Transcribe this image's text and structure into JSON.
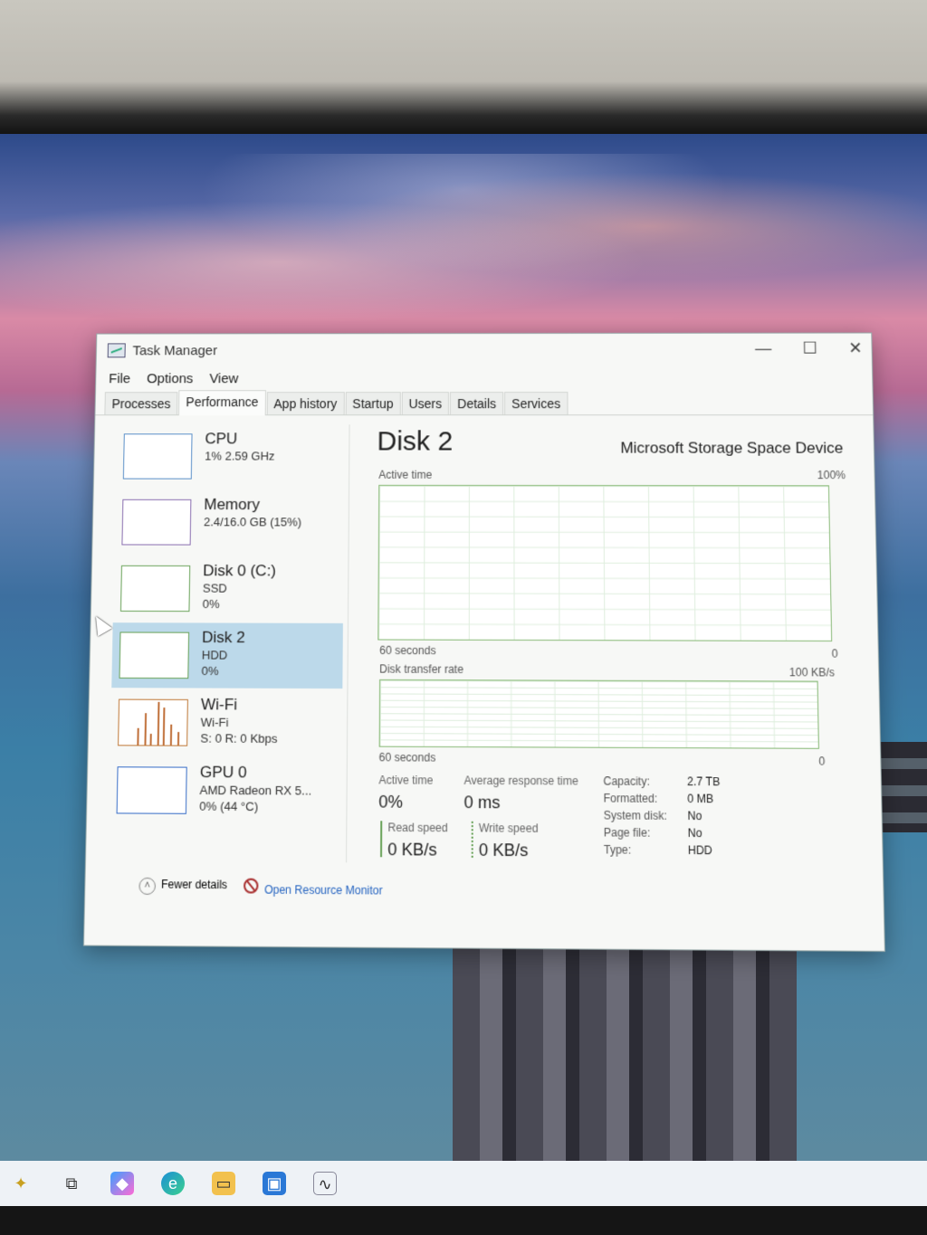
{
  "window": {
    "title": "Task Manager",
    "controls": {
      "minimize": "—",
      "maximize": "☐",
      "close": "✕"
    }
  },
  "menu": [
    "File",
    "Options",
    "View"
  ],
  "tabs": [
    "Processes",
    "Performance",
    "App history",
    "Startup",
    "Users",
    "Details",
    "Services"
  ],
  "active_tab": "Performance",
  "sidebar": [
    {
      "name": "CPU",
      "sub1": "1% 2.59 GHz",
      "sub2": "",
      "sub3": ""
    },
    {
      "name": "Memory",
      "sub1": "2.4/16.0 GB (15%)",
      "sub2": "",
      "sub3": ""
    },
    {
      "name": "Disk 0 (C:)",
      "sub1": "SSD",
      "sub2": "0%",
      "sub3": ""
    },
    {
      "name": "Disk 2",
      "sub1": "HDD",
      "sub2": "0%",
      "sub3": ""
    },
    {
      "name": "Wi-Fi",
      "sub1": "Wi-Fi",
      "sub2": "S: 0 R: 0 Kbps",
      "sub3": ""
    },
    {
      "name": "GPU 0",
      "sub1": "AMD Radeon RX 5...",
      "sub2": "0% (44 °C)",
      "sub3": ""
    }
  ],
  "selected_item": "Disk 2",
  "detail": {
    "title": "Disk 2",
    "device": "Microsoft Storage Space Device",
    "graph1": {
      "label": "Active time",
      "max": "100%",
      "time": "60 seconds",
      "min": "0"
    },
    "graph2": {
      "label": "Disk transfer rate",
      "max": "100 KB/s",
      "time": "60 seconds",
      "min": "0"
    },
    "stats": {
      "active_time_label": "Active time",
      "active_time_value": "0%",
      "avg_response_label": "Average response time",
      "avg_response_value": "0 ms",
      "read_speed_label": "Read speed",
      "read_speed_value": "0 KB/s",
      "write_speed_label": "Write speed",
      "write_speed_value": "0 KB/s"
    },
    "properties": [
      {
        "label": "Capacity:",
        "value": "2.7 TB"
      },
      {
        "label": "Formatted:",
        "value": "0 MB"
      },
      {
        "label": "System disk:",
        "value": "No"
      },
      {
        "label": "Page file:",
        "value": "No"
      },
      {
        "label": "Type:",
        "value": "HDD"
      }
    ]
  },
  "footer": {
    "fewer_details": "Fewer details",
    "resource_monitor": "Open Resource Monitor"
  },
  "taskbar_icons": [
    "task-view-icon",
    "copilot-icon",
    "edge-icon",
    "file-explorer-icon",
    "store-icon",
    "task-manager-icon"
  ],
  "colors": {
    "selected_bg": "#bcd9ea",
    "disk_graph_border": "#8bbb7a",
    "link": "#2463c0"
  }
}
